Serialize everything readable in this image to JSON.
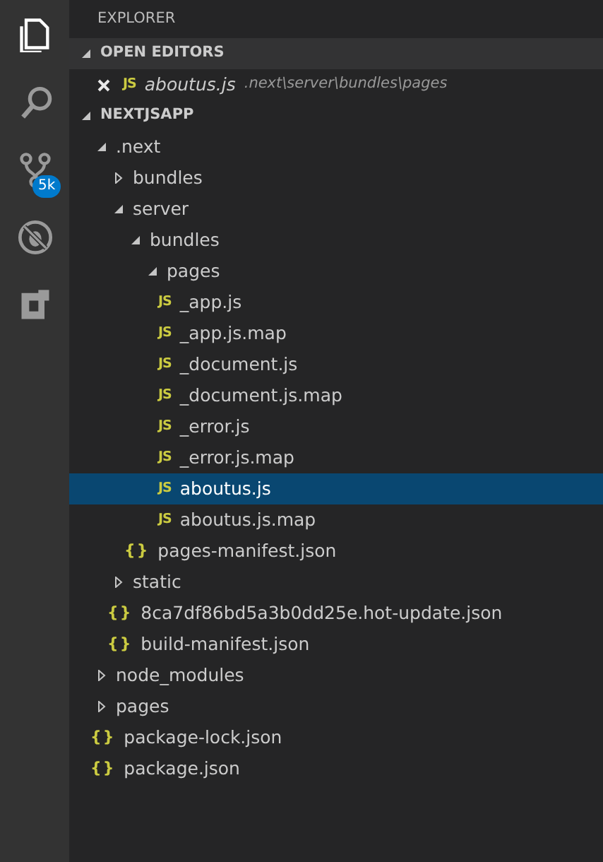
{
  "activity_bar": {
    "items": [
      {
        "kind": "files",
        "selected": true
      },
      {
        "kind": "search",
        "selected": false
      },
      {
        "kind": "scm",
        "selected": false,
        "badge": "5k"
      },
      {
        "kind": "debug",
        "selected": false
      },
      {
        "kind": "extensions",
        "selected": false
      }
    ]
  },
  "sidebar": {
    "title": "EXPLORER",
    "open_editors": {
      "title": "OPEN EDITORS",
      "expanded": true,
      "items": [
        {
          "icon": "JS",
          "kind": "js",
          "name": "aboutus.js",
          "path": ".next\\server\\bundles\\pages"
        }
      ]
    },
    "folder": {
      "title": "NEXTJSAPP",
      "expanded": true,
      "tree": [
        {
          "name": ".next",
          "kind": "folder",
          "expanded": true,
          "selected": false,
          "children": [
            {
              "name": "bundles",
              "kind": "folder",
              "expanded": false,
              "selected": false
            },
            {
              "name": "server",
              "kind": "folder",
              "expanded": true,
              "selected": false,
              "children": [
                {
                  "name": "bundles",
                  "kind": "folder",
                  "expanded": true,
                  "selected": false,
                  "children": [
                    {
                      "name": "pages",
                      "kind": "folder",
                      "expanded": true,
                      "selected": false,
                      "children": [
                        {
                          "name": "_app.js",
                          "kind": "js",
                          "icon": "JS",
                          "selected": false
                        },
                        {
                          "name": "_app.js.map",
                          "kind": "js",
                          "icon": "JS",
                          "selected": false
                        },
                        {
                          "name": "_document.js",
                          "kind": "js",
                          "icon": "JS",
                          "selected": false
                        },
                        {
                          "name": "_document.js.map",
                          "kind": "js",
                          "icon": "JS",
                          "selected": false
                        },
                        {
                          "name": "_error.js",
                          "kind": "js",
                          "icon": "JS",
                          "selected": false
                        },
                        {
                          "name": "_error.js.map",
                          "kind": "js",
                          "icon": "JS",
                          "selected": false
                        },
                        {
                          "name": "aboutus.js",
                          "kind": "js",
                          "icon": "JS",
                          "selected": true
                        },
                        {
                          "name": "aboutus.js.map",
                          "kind": "js",
                          "icon": "JS",
                          "selected": false
                        }
                      ]
                    }
                  ]
                },
                {
                  "name": "pages-manifest.json",
                  "kind": "json",
                  "icon": "{}",
                  "selected": false
                }
              ]
            },
            {
              "name": "static",
              "kind": "folder",
              "expanded": false,
              "selected": false
            },
            {
              "name": "8ca7df86bd5a3b0dd25e.hot-update.json",
              "kind": "json",
              "icon": "{}",
              "selected": false
            },
            {
              "name": "build-manifest.json",
              "kind": "json",
              "icon": "{}",
              "selected": false
            }
          ]
        },
        {
          "name": "node_modules",
          "kind": "folder",
          "expanded": false,
          "selected": false
        },
        {
          "name": "pages",
          "kind": "folder",
          "expanded": false,
          "selected": false
        },
        {
          "name": "package-lock.json",
          "kind": "json",
          "icon": "{}",
          "selected": false
        },
        {
          "name": "package.json",
          "kind": "json",
          "icon": "{}",
          "selected": false
        }
      ]
    }
  }
}
